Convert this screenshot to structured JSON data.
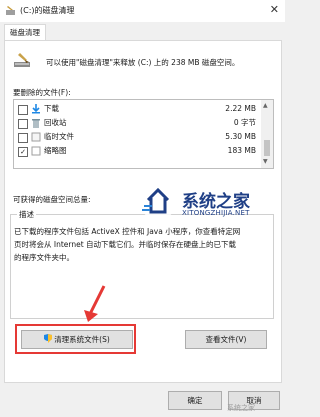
{
  "window": {
    "title": "(C:)的磁盘清理"
  },
  "tab": {
    "label": "磁盘清理"
  },
  "intro": {
    "text": "可以使用\"磁盘清理\"来释放  (C:)  上的 238 MB 磁盘空间。"
  },
  "files": {
    "label": "要删除的文件(F):",
    "items": [
      {
        "name": "下载",
        "size": "2.22 MB",
        "checked": false,
        "icon": "download-icon"
      },
      {
        "name": "回收站",
        "size": "0 字节",
        "checked": false,
        "icon": "recycle-bin-icon"
      },
      {
        "name": "临时文件",
        "size": "5.30 MB",
        "checked": false,
        "icon": "temp-files-icon"
      },
      {
        "name": "缩略图",
        "size": "183 MB",
        "checked": true,
        "icon": "thumbnails-icon"
      }
    ]
  },
  "gain": {
    "label": "可获得的磁盘空间总量:"
  },
  "description": {
    "legend": "描述",
    "text": "已下载的程序文件包括 ActiveX 控件和 Java 小程序，你查看特定网\n页时将会从 Internet 自动下载它们。并临时保存在硬盘上的已下载\n的程序文件夹中。"
  },
  "buttons": {
    "clean_system": "清理系统文件(S)",
    "view_files": "查看文件(V)",
    "ok": "确定",
    "cancel": "取消"
  },
  "watermark": {
    "title": "系统之家",
    "url": "XITONGZHIJIA.NET",
    "badge": "系统之家"
  },
  "colors": {
    "highlight": "#e53935",
    "watermark": "#1f3f86"
  }
}
